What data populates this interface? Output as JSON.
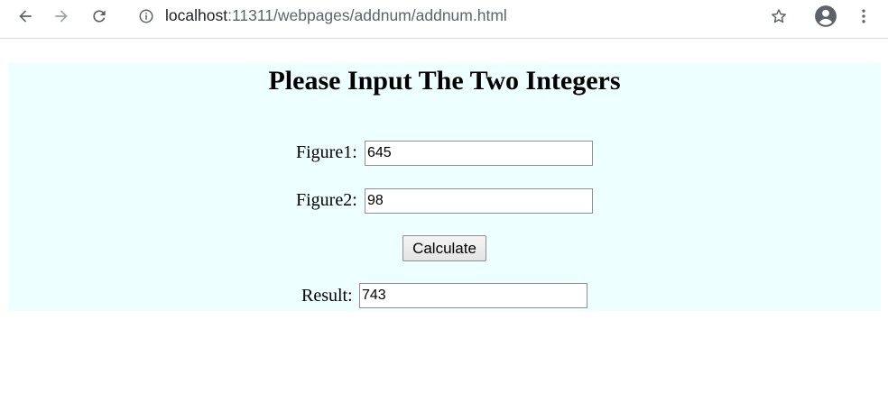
{
  "browser": {
    "url_host": "localhost",
    "url_path": ":11311/webpages/addnum/addnum.html"
  },
  "page": {
    "heading": "Please Input The Two Integers",
    "figure1_label": "Figure1:",
    "figure1_value": "645",
    "figure2_label": "Figure2:",
    "figure2_value": "98",
    "calculate_label": "Calculate",
    "result_label": "Result:",
    "result_value": "743"
  },
  "icons": {
    "back": "back-arrow-icon",
    "forward": "forward-arrow-icon",
    "reload": "reload-icon",
    "info": "info-icon",
    "bookmark": "star-icon",
    "account": "account-icon",
    "menu": "kebab-menu-icon"
  },
  "colors": {
    "panel_background": "#eeffff"
  }
}
